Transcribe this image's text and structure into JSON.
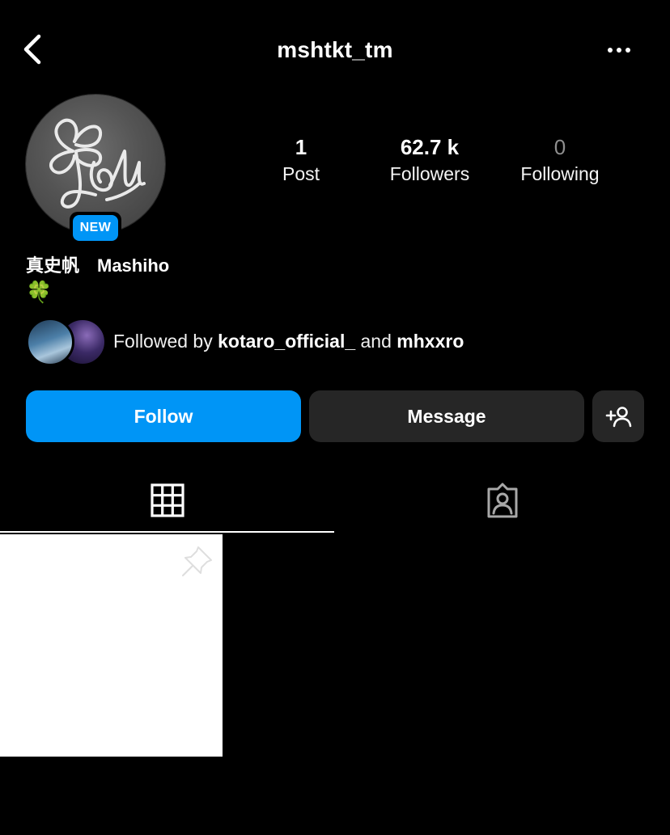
{
  "header": {
    "username": "mshtkt_tm",
    "back_icon": "chevron-left-icon",
    "more_icon": "more-horizontal-icon"
  },
  "profile": {
    "new_badge": "NEW",
    "bio_name": "真史帆　Mashiho",
    "bio_emoji": "🍀"
  },
  "stats": {
    "posts_count": "1",
    "posts_label": "Post",
    "followers_count": "62.7 k",
    "followers_label": "Followers",
    "following_count": "0",
    "following_label": "Following"
  },
  "followed_by": {
    "prefix": "Followed by ",
    "user1": "kotaro_official_",
    "conjunction": " and ",
    "user2": "mhxxro"
  },
  "actions": {
    "follow_label": "Follow",
    "message_label": "Message",
    "add_user_icon": "add-user-icon"
  },
  "tabs": {
    "grid_icon": "grid-icon",
    "tagged_icon": "tagged-user-icon",
    "active": "grid"
  },
  "colors": {
    "accent": "#0095f6",
    "background": "#000000",
    "button_dark": "#262626",
    "muted_text": "#8e8e8e"
  }
}
